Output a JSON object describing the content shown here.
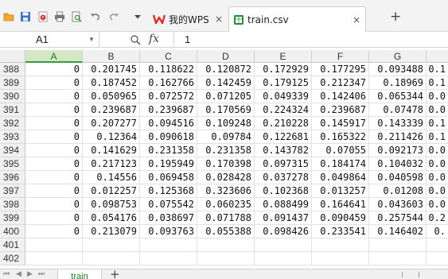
{
  "tabs": [
    {
      "label": "我的WPS",
      "close": "×"
    },
    {
      "label": "train.csv",
      "close": "×"
    }
  ],
  "new_tab": "+",
  "formula": {
    "cell_ref": "A1",
    "fx_label": "fx",
    "value": "1"
  },
  "columns": [
    "A",
    "B",
    "C",
    "D",
    "E",
    "F",
    "G",
    ""
  ],
  "selected_column": "A",
  "rows": [
    {
      "n": "388",
      "cells": [
        "0",
        "0.201745",
        "0.118622",
        "0.120872",
        "0.172929",
        "0.177295",
        "0.093488",
        "0.1"
      ]
    },
    {
      "n": "389",
      "cells": [
        "0",
        "0.187452",
        "0.162766",
        "0.142459",
        "0.179125",
        "0.212347",
        "0.18969",
        "0.1"
      ]
    },
    {
      "n": "390",
      "cells": [
        "0",
        "0.050965",
        "0.072572",
        "0.071205",
        "0.049339",
        "0.142406",
        "0.065344",
        "0.0"
      ]
    },
    {
      "n": "391",
      "cells": [
        "0",
        "0.239687",
        "0.239687",
        "0.170569",
        "0.224324",
        "0.239687",
        "0.07478",
        "0.0"
      ]
    },
    {
      "n": "392",
      "cells": [
        "0",
        "0.207277",
        "0.094516",
        "0.109248",
        "0.210228",
        "0.145917",
        "0.143339",
        "0.1"
      ]
    },
    {
      "n": "393",
      "cells": [
        "0",
        "0.12364",
        "0.090618",
        "0.09784",
        "0.122681",
        "0.165322",
        "0.211426",
        "0.1"
      ]
    },
    {
      "n": "394",
      "cells": [
        "0",
        "0.141629",
        "0.231358",
        "0.231358",
        "0.143782",
        "0.07055",
        "0.092173",
        "0.0"
      ]
    },
    {
      "n": "395",
      "cells": [
        "0",
        "0.217123",
        "0.195949",
        "0.170398",
        "0.097315",
        "0.184174",
        "0.104032",
        "0.0"
      ]
    },
    {
      "n": "396",
      "cells": [
        "0",
        "0.14556",
        "0.069458",
        "0.028428",
        "0.037278",
        "0.049864",
        "0.040598",
        "0.0"
      ]
    },
    {
      "n": "397",
      "cells": [
        "0",
        "0.012257",
        "0.125368",
        "0.323606",
        "0.102368",
        "0.013257",
        "0.01208",
        "0.0"
      ]
    },
    {
      "n": "398",
      "cells": [
        "0",
        "0.098753",
        "0.075542",
        "0.060235",
        "0.088499",
        "0.164641",
        "0.043603",
        "0.0"
      ]
    },
    {
      "n": "399",
      "cells": [
        "0",
        "0.054176",
        "0.038697",
        "0.071788",
        "0.091437",
        "0.090459",
        "0.257544",
        "0.2"
      ]
    },
    {
      "n": "400",
      "cells": [
        "0",
        "0.213079",
        "0.093763",
        "0.055388",
        "0.098426",
        "0.233541",
        "0.146402",
        "0."
      ]
    },
    {
      "n": "401",
      "cells": [
        "",
        "",
        "",
        "",
        "",
        "",
        "",
        ""
      ]
    },
    {
      "n": "402",
      "cells": [
        "",
        "",
        "",
        "",
        "",
        "",
        "",
        ""
      ]
    }
  ],
  "sheet_tabs": [
    "train"
  ],
  "add_sheet": "+",
  "colors": {
    "accent_green": "#1e7a2b",
    "selected_header": "#d5e8c5",
    "wps_red": "#d9312c"
  }
}
